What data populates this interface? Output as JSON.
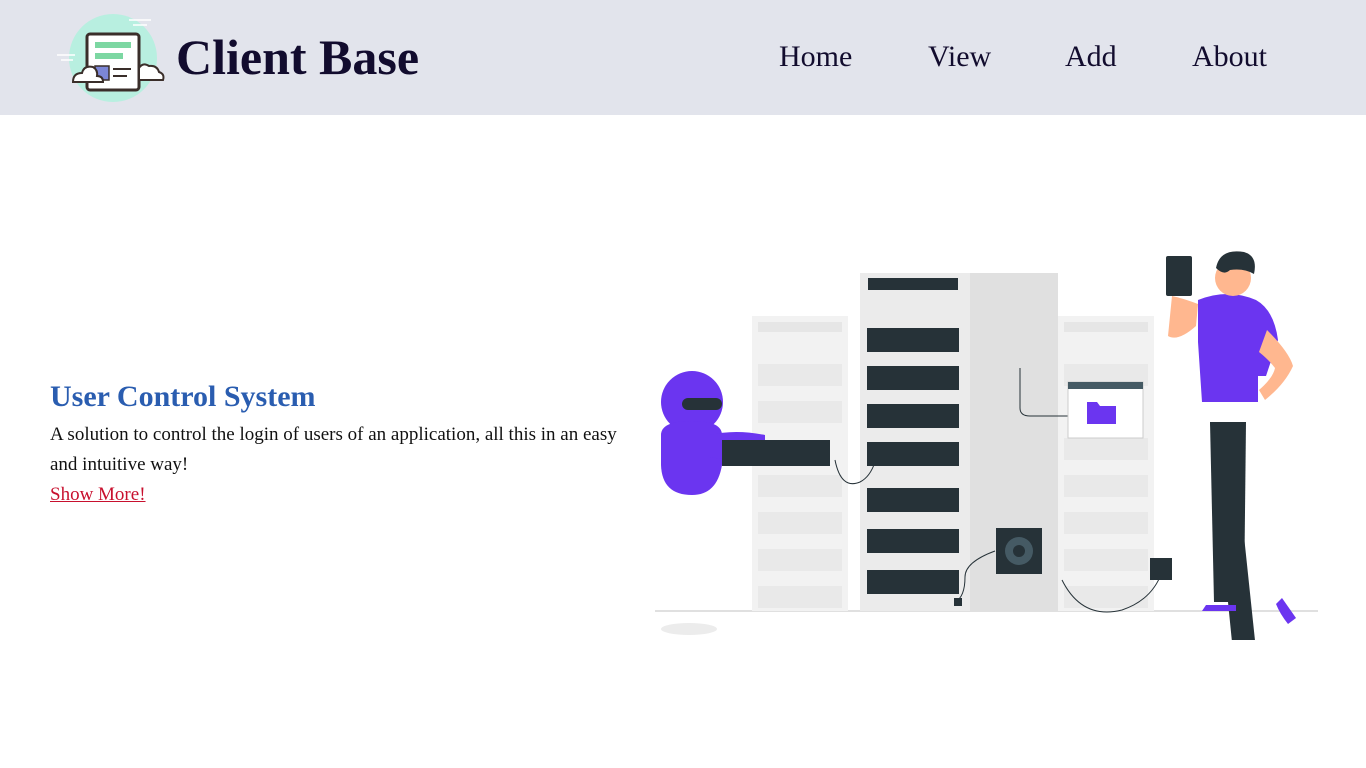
{
  "header": {
    "brand": "Client Base",
    "nav": [
      {
        "label": "Home"
      },
      {
        "label": "View"
      },
      {
        "label": "Add"
      },
      {
        "label": "About"
      }
    ]
  },
  "hero": {
    "title": "User Control System",
    "description": "A solution to control the login of users of an application, all this in an easy and intuitive way!",
    "link_label": "Show More!"
  },
  "colors": {
    "header_bg": "#e2e4ec",
    "brand_text": "#120c2e",
    "title": "#2a5db0",
    "link": "#c8102e",
    "accent_purple": "#6b35f0",
    "rack_dark": "#263238"
  },
  "icons": {
    "logo": "client-base-logo-icon",
    "illustration": "server-room-illustration"
  }
}
